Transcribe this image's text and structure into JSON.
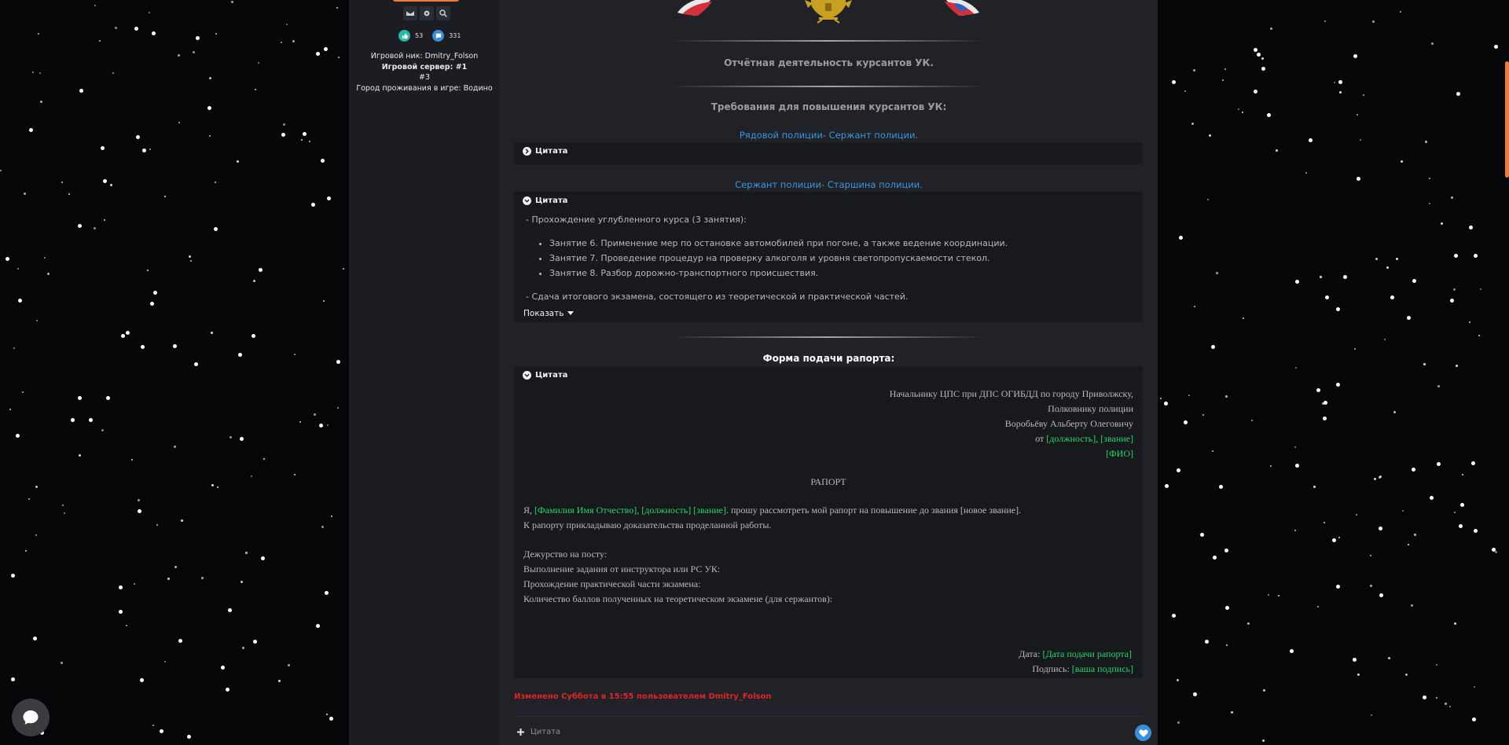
{
  "user": {
    "likes": "53",
    "messages": "331",
    "game_nick": "Игровой ник: Dmitry_Folson",
    "game_server": "Игровой сервер: #1",
    "server_num": "#3",
    "city": "Город проживания в игре: Водино",
    "actions": [
      "envelope-icon",
      "gear-icon",
      "search-icon"
    ]
  },
  "post": {
    "section_report": "Отчётная деятельность курсантов УК.",
    "section_requirements": "Требования для повышения курсантов УК:",
    "link1": "Рядовой полиции- Сержант полиции.",
    "link2": "Сержант полиции- Старшина полиции.",
    "quote_label": "Цитата",
    "quote2": {
      "intro": "- Прохождение углубленного курса (3 занятия):",
      "items": [
        "Занятие 6. Применение мер по остановке автомобилей при погоне, а также ведение координации.",
        "Занятие 7. Проведение процедур на проверку алкоголя и уровня светопропускаемости стекол.",
        "Занятие 8. Разбор дорожно-транспортного происшествия."
      ],
      "exam": "- Сдача итогового экзамена, состоящего из теоретической и практической частей.",
      "show_more": "Показать"
    },
    "form_title": "Форма подачи рапорта:",
    "form": {
      "addr1": "Начальнику ЦПС при ДПС ОГИБДД по городу Приволжску,",
      "addr2": "Полковнику полиции",
      "addr3": "Воробьёву Альберту Олеговичу",
      "from_prefix": "от ",
      "from_green": "[должность], [звание]",
      "fio": "[ФИО]",
      "title": "РАПОРТ",
      "body_prefix": "Я, ",
      "body_green": "[Фамилия Имя Отчество], [должность] [звание]",
      "body_suffix": ". прошу рассмотреть мой рапорт на повышение до звания [новое звание].",
      "body2": "К рапорту прикладываю доказательства проделанной работы.",
      "duty": "Дежурство на посту:",
      "task": "Выполнение задания от инструктора или РС УК:",
      "practice": "Прохождение практической части экзамена:",
      "theory": "Количество баллов полученных на теоретическом экзамене (для сержантов):",
      "date_prefix": "Дата: ",
      "date_green": "[Дата подачи рапорта]",
      "sign_prefix": "Подпись: ",
      "sign_green": "[ваша подпись]"
    },
    "edited": "Изменено Суббота в 15:55 пользователем Dmitry_Folson",
    "reply": "Цитата"
  },
  "colors": {
    "accent_orange": "#f07b36",
    "link_blue": "#3a96e0",
    "green": "#2bd46b",
    "edited_red": "#e0242b"
  }
}
